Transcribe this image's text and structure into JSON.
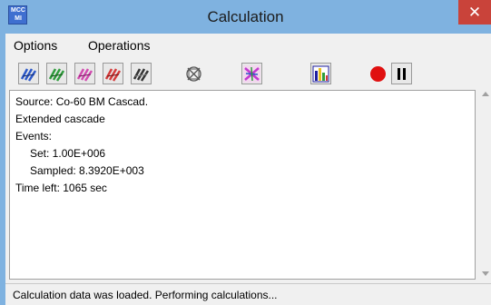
{
  "window": {
    "title": "Calculation",
    "icon_text_line1": "MCC",
    "icon_text_line2": "MI",
    "close_glyph": "✕",
    "titlebar_color": "#7fb2e0",
    "close_color": "#c9433a"
  },
  "menu": {
    "items": [
      {
        "label": "Options"
      },
      {
        "label": "Operations"
      }
    ]
  },
  "toolbar": {
    "buttons": [
      {
        "icon": "blue-particle-tracks-icon",
        "color": "#2c58c8"
      },
      {
        "icon": "green-particle-tracks-icon",
        "color": "#2f9c3c"
      },
      {
        "icon": "magenta-particle-tracks-icon",
        "color": "#d24bb0"
      },
      {
        "icon": "red-particle-tracks-icon",
        "color": "#d43a3a"
      },
      {
        "icon": "black-particle-tracks-icon",
        "color": "#333333"
      },
      {
        "icon": "clear-tracks-icon",
        "color": "#555555"
      },
      {
        "icon": "color-tracks-icon",
        "color": "#c23ad0"
      },
      {
        "icon": "histogram-icon",
        "color": "#1f1fa0"
      },
      {
        "icon": "record-icon",
        "color": "#e01010"
      },
      {
        "icon": "pause-icon",
        "color": "#000000"
      }
    ]
  },
  "output": {
    "lines": [
      "Source: Co-60 BM Cascad.",
      "Extended cascade",
      "Events:",
      "Set: 1.00E+006",
      "Sampled: 8.3920E+003",
      "Time left: 1065 sec"
    ]
  },
  "status": {
    "text": "Calculation data was loaded. Performing calculations..."
  }
}
